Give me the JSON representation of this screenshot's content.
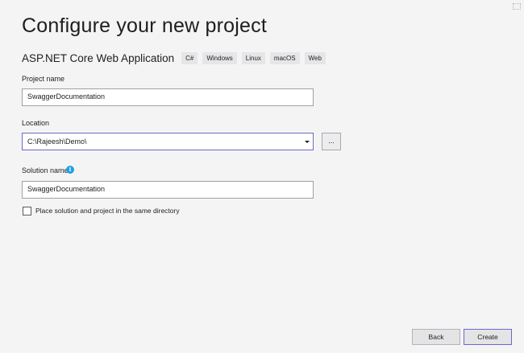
{
  "page": {
    "title": "Configure your new project"
  },
  "template": {
    "name": "ASP.NET Core Web Application",
    "tags": [
      "C#",
      "Windows",
      "Linux",
      "macOS",
      "Web"
    ]
  },
  "project_name": {
    "label": "Project name",
    "value": "SwaggerDocumentation"
  },
  "location": {
    "label": "Location",
    "value": "C:\\Rajeesh\\Demo\\",
    "browse_label": "..."
  },
  "solution_name": {
    "label": "Solution name",
    "info_glyph": "i",
    "value": "SwaggerDocumentation"
  },
  "same_directory": {
    "label": "Place solution and project in the same directory",
    "checked": false
  },
  "footer": {
    "back_label": "Back",
    "create_label": "Create"
  },
  "icons": {
    "info": "info-icon",
    "dropdown": "chevron-down-icon"
  },
  "colors": {
    "background": "#f4f4f5",
    "focus_border": "#6a6ac8",
    "info_blue": "#1ba1e2"
  }
}
